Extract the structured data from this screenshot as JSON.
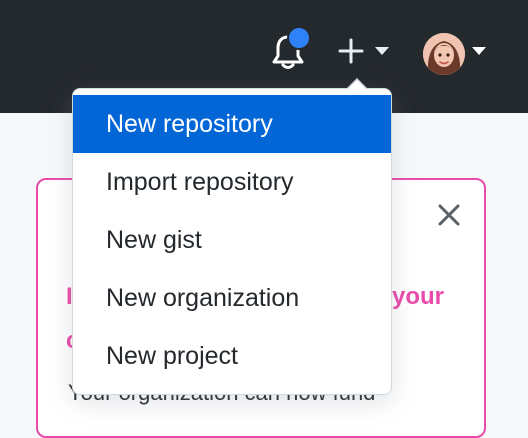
{
  "header": {
    "notification_icon": "bell-icon",
    "notification_indicator_color": "#2f81f7",
    "create_icon": "plus-icon",
    "create_caret_icon": "caret-down-icon",
    "avatar_icon": "user-avatar",
    "avatar_caret_icon": "caret-down-icon"
  },
  "create_menu": {
    "items": [
      {
        "label": "New repository",
        "active": true
      },
      {
        "label": "Import repository",
        "active": false
      },
      {
        "label": "New gist",
        "active": false
      },
      {
        "label": "New organization",
        "active": false
      },
      {
        "label": "New project",
        "active": false
      }
    ],
    "active_color": "#0366d6"
  },
  "promo_card": {
    "close_icon": "close-icon",
    "title_left": "I",
    "title_right": "your",
    "title_line2": "c",
    "body": "Your organization can now fund",
    "accent_color": "#ea4aaa"
  }
}
